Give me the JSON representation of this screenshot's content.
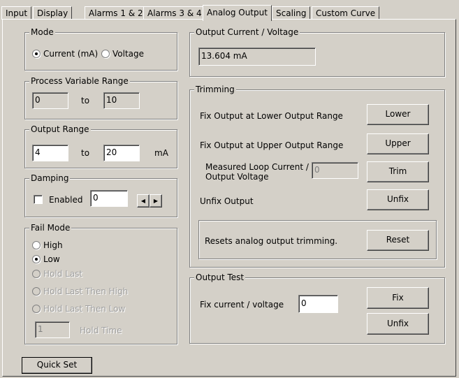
{
  "tabs": [
    {
      "label": "Input"
    },
    {
      "label": "Display"
    },
    {
      "label": "Alarms 1 & 2"
    },
    {
      "label": "Alarms 3 & 4"
    },
    {
      "label": "Analog Output",
      "active": true
    },
    {
      "label": "Scaling"
    },
    {
      "label": "Custom Curve"
    }
  ],
  "mode": {
    "title": "Mode",
    "current_label": "Current (mA)",
    "voltage_label": "Voltage",
    "selected": "current"
  },
  "pv_range": {
    "title": "Process Variable Range",
    "low": "0",
    "to": "to",
    "high": "10"
  },
  "output_range": {
    "title": "Output Range",
    "low": "4",
    "to": "to",
    "high": "20",
    "unit": "mA"
  },
  "damping": {
    "title": "Damping",
    "enabled_label": "Enabled",
    "enabled": false,
    "value": "0",
    "left_arrow": "◀",
    "right_arrow": "▶"
  },
  "fail_mode": {
    "title": "Fail Mode",
    "options": [
      {
        "label": "High",
        "enabled": true,
        "selected": false
      },
      {
        "label": "Low",
        "enabled": true,
        "selected": true
      },
      {
        "label": "Hold Last",
        "enabled": false,
        "selected": false
      },
      {
        "label": "Hold Last Then High",
        "enabled": false,
        "selected": false
      },
      {
        "label": "Hold Last Then Low",
        "enabled": false,
        "selected": false
      }
    ],
    "hold_time_value": "1",
    "hold_time_label": "Hold Time"
  },
  "quick_set_label": "Quick Set",
  "output_current": {
    "title": "Output Current / Voltage",
    "value": "13.604 mA"
  },
  "trimming": {
    "title": "Trimming",
    "lower_text": "Fix Output at Lower Output Range",
    "lower_button": "Lower",
    "upper_text": "Fix Output at Upper Output Range",
    "upper_button": "Upper",
    "measured_text_1": "Measured Loop Current /",
    "measured_text_2": "Output Voltage",
    "measured_value": "0",
    "trim_button": "Trim",
    "unfix_text": "Unfix Output",
    "unfix_button": "Unfix",
    "reset_text": "Resets analog output trimming.",
    "reset_button": "Reset"
  },
  "output_test": {
    "title": "Output Test",
    "label": "Fix current / voltage",
    "value": "0",
    "fix_button": "Fix",
    "unfix_button": "Unfix"
  }
}
